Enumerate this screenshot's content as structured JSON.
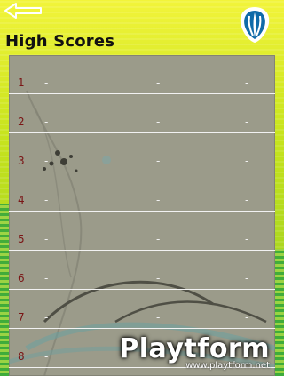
{
  "header": {
    "back_icon": "back-arrow-icon",
    "logo_icon": "app-logo-icon"
  },
  "title": "High Scores",
  "scores": [
    {
      "rank": "1",
      "c1": "-",
      "c2": "-",
      "c3": "-"
    },
    {
      "rank": "2",
      "c1": "-",
      "c2": "-",
      "c3": "-"
    },
    {
      "rank": "3",
      "c1": "-",
      "c2": "-",
      "c3": "-"
    },
    {
      "rank": "4",
      "c1": "-",
      "c2": "-",
      "c3": "-"
    },
    {
      "rank": "5",
      "c1": "-",
      "c2": "-",
      "c3": "-"
    },
    {
      "rank": "6",
      "c1": "-",
      "c2": "-",
      "c3": "-"
    },
    {
      "rank": "7",
      "c1": "-",
      "c2": "-",
      "c3": "-"
    },
    {
      "rank": "8",
      "c1": "-",
      "c2": "-",
      "c3": "-"
    }
  ],
  "watermark": {
    "brand": "Playtform",
    "site": "www.playtform.net"
  },
  "colors": {
    "panel": "#9b9b8a",
    "rank_text": "#7a1616",
    "divider": "#f2f2f2"
  }
}
